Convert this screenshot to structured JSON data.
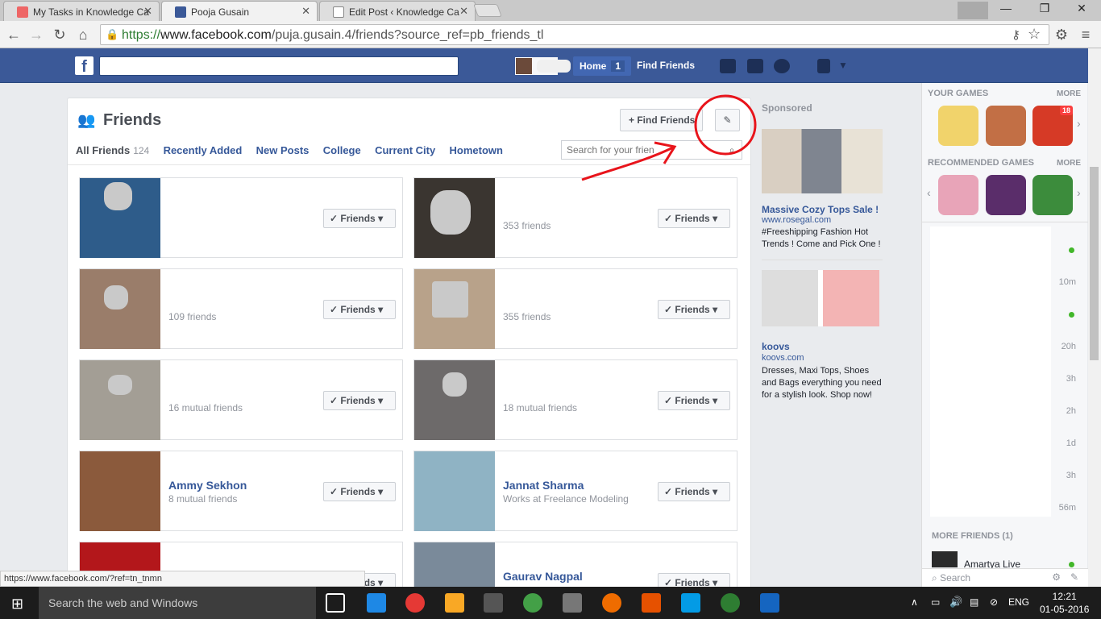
{
  "browser": {
    "tabs": [
      {
        "title": "My Tasks in Knowledge Ca"
      },
      {
        "title": "Pooja Gusain"
      },
      {
        "title": "Edit Post ‹ Knowledge Ca"
      }
    ],
    "url_scheme": "https://",
    "url_host": "www.facebook.com",
    "url_path": "/puja.gusain.4/friends?source_ref=pb_friends_tl",
    "status_url": "https://www.facebook.com/?ref=tn_tnmn"
  },
  "fbbar": {
    "home_label": "Home",
    "home_count": "1",
    "find_friends": "Find Friends"
  },
  "friends": {
    "title": "Friends",
    "find_button": "Find Friends",
    "tabs": [
      {
        "label": "All Friends",
        "count": "124"
      },
      {
        "label": "Recently Added"
      },
      {
        "label": "New Posts"
      },
      {
        "label": "College"
      },
      {
        "label": "Current City"
      },
      {
        "label": "Hometown"
      }
    ],
    "search_placeholder": "Search for your frien",
    "friend_button": "Friends",
    "cards": [
      {
        "name": "",
        "sub": ""
      },
      {
        "name": "",
        "sub": "353 friends"
      },
      {
        "name": "",
        "sub": "109 friends"
      },
      {
        "name": "",
        "sub": "355 friends"
      },
      {
        "name": "",
        "sub": "16 mutual friends"
      },
      {
        "name": "",
        "sub": "18 mutual friends"
      },
      {
        "name": "Ammy Sekhon",
        "sub": "8 mutual friends"
      },
      {
        "name": "Jannat Sharma",
        "sub": "Works at Freelance Modeling"
      },
      {
        "name": "",
        "sub": ""
      },
      {
        "name": "Gaurav Nagpal",
        "sub": ""
      }
    ]
  },
  "ads": {
    "sponsored": "Sponsored",
    "ad1": {
      "title": "Massive Cozy Tops Sale !",
      "domain": "www.rosegal.com",
      "text": "#Freeshipping Fashion Hot Trends ! Come and Pick One !"
    },
    "ad2": {
      "title": "koovs",
      "domain": "koovs.com",
      "text": "Dresses, Maxi Tops, Shoes and Bags everything you need for a stylish look. Shop now!"
    }
  },
  "chat": {
    "your_games": "YOUR GAMES",
    "more": "MORE",
    "recommended_games": "RECOMMENDED GAMES",
    "game_badge": "18",
    "times": [
      "10m",
      "20h",
      "3h",
      "2h",
      "1d",
      "3h",
      "56m"
    ],
    "more_friends": "MORE FRIENDS (1)",
    "more_friend_name": "Amartya Live",
    "search": "Search"
  },
  "taskbar": {
    "search": "Search the web and Windows",
    "lang": "ENG",
    "time": "12:21",
    "date": "01-05-2016"
  },
  "colors": {
    "fb_blue": "#3b5998",
    "link": "#365899",
    "annotation": "#e8141b"
  }
}
